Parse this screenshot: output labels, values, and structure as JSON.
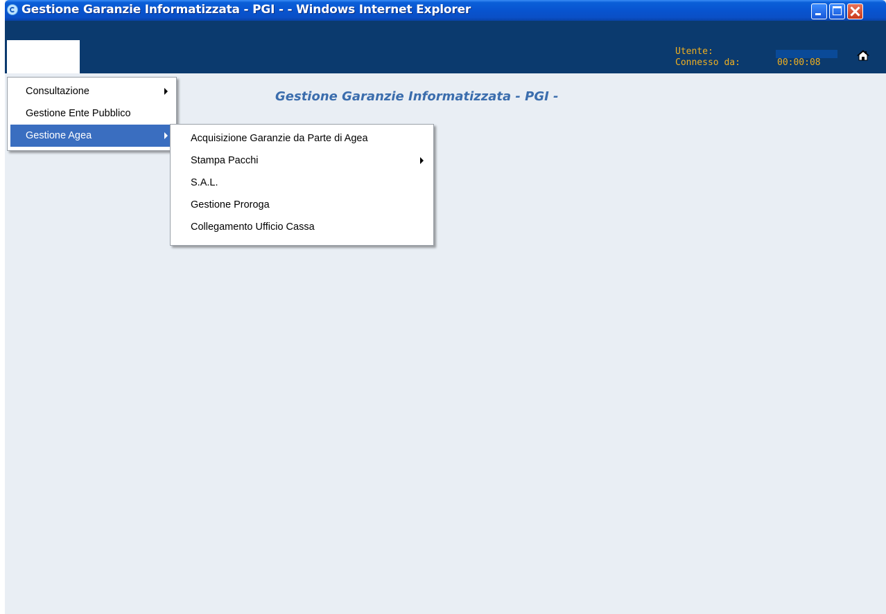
{
  "window": {
    "title": "Gestione Garanzie Informatizzata - PGI - - Windows Internet Explorer"
  },
  "header": {
    "user_label": "Utente:",
    "connected_label": "Connesso da:",
    "connected_time": "00:00:08",
    "home_icon": "home-icon"
  },
  "page": {
    "title": "Gestione Garanzie Informatizzata - PGI -"
  },
  "menu": {
    "items": [
      {
        "label": "Consultazione",
        "has_submenu": true
      },
      {
        "label": "Gestione Ente Pubblico",
        "has_submenu": false
      },
      {
        "label": "Gestione Agea",
        "has_submenu": true,
        "selected": true
      }
    ]
  },
  "submenu": {
    "items": [
      {
        "label": "Acquisizione Garanzie da Parte di Agea",
        "has_submenu": false
      },
      {
        "label": "Stampa Pacchi",
        "has_submenu": true
      },
      {
        "label": "S.A.L.",
        "has_submenu": false
      },
      {
        "label": "Gestione Proroga",
        "has_submenu": false
      },
      {
        "label": "Collegamento Ufficio Cassa",
        "has_submenu": false
      }
    ]
  },
  "colors": {
    "titlebar": "#0854d0",
    "header_bg": "#0b3a6e",
    "header_text": "#f0b020",
    "page_bg": "#e9eef4",
    "page_title": "#3b6dad",
    "menu_selected": "#3a6ec0"
  }
}
